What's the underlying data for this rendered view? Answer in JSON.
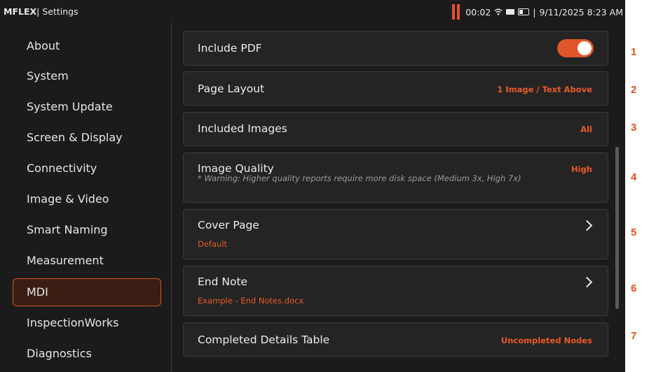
{
  "status_bar": {
    "brand": "MFLEX",
    "separator": "|",
    "section": "Settings",
    "timer": "00:02",
    "datetime": "9/11/2025  8:23 AM",
    "icons": [
      "record-pause-icon",
      "wifi-icon",
      "sd-card-icon",
      "battery-icon"
    ],
    "accent_color": "#e84e2a"
  },
  "sidebar": {
    "items": [
      {
        "label": "About"
      },
      {
        "label": "System"
      },
      {
        "label": "System Update"
      },
      {
        "label": "Screen & Display"
      },
      {
        "label": "Connectivity"
      },
      {
        "label": "Image & Video"
      },
      {
        "label": "Smart Naming"
      },
      {
        "label": "Measurement"
      },
      {
        "label": "MDI",
        "selected": true
      },
      {
        "label": "InspectionWorks"
      },
      {
        "label": "Diagnostics"
      }
    ]
  },
  "settings": {
    "include_pdf": {
      "label": "Include PDF",
      "enabled": true
    },
    "page_layout": {
      "label": "Page Layout",
      "value": "1 Image / Text Above"
    },
    "included_images": {
      "label": "Included Images",
      "value": "All"
    },
    "image_quality": {
      "label": "Image Quality",
      "value": "High",
      "note": "* Warning: Higher quality reports require more disk space (Medium 3x, High 7x)"
    },
    "cover_page": {
      "label": "Cover Page",
      "value": "Default"
    },
    "end_note": {
      "label": "End Note",
      "value": "Example - End Notes.docx"
    },
    "completed_details_table": {
      "label": "Completed Details Table",
      "value": "Uncompleted Nodes"
    }
  },
  "callouts": [
    "1",
    "2",
    "3",
    "4",
    "5",
    "6",
    "7"
  ],
  "colors": {
    "accent": "#e2552b",
    "background": "#1b1b1b",
    "card": "#242424"
  }
}
